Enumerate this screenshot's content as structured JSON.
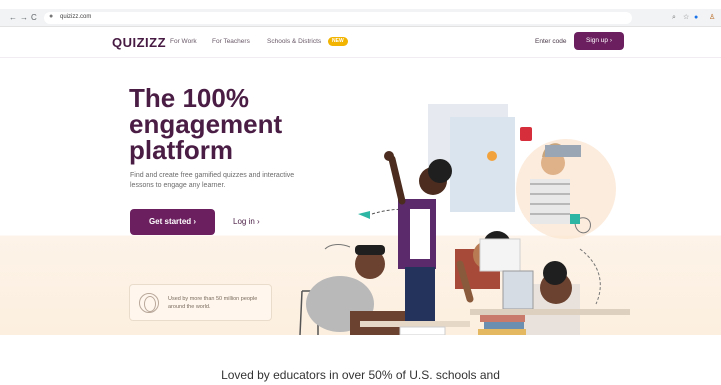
{
  "browser": {
    "url": "quizizz.com",
    "back_glyph": "←",
    "forward_glyph": "→",
    "reload_glyph": "C",
    "lock_glyph": "●",
    "extensions": [
      "⌕",
      "☆",
      "●",
      "♙"
    ]
  },
  "header": {
    "logo": "QUIZIZZ",
    "nav": [
      "For Work",
      "For Teachers",
      "Schools & Districts"
    ],
    "new_badge": "NEW",
    "enter_code": "Enter code",
    "signup": "Sign up ›"
  },
  "hero": {
    "title_lines": [
      "The 100%",
      "engagement",
      "platform"
    ],
    "subtitle": "Find and create free gamified quizzes and interactive lessons to engage any learner.",
    "cta": "Get started ›",
    "login": "Log in ›",
    "stat": "Used by more than 50 million people around the world.",
    "illustration": "students-celebrating-illustration"
  },
  "loved": "Loved by educators in over 50% of U.S. schools and",
  "colors": {
    "brand": "#6b1f5f",
    "title": "#4a1d45",
    "badge": "#f2b400",
    "hero_bottom": "#fcefdf"
  }
}
